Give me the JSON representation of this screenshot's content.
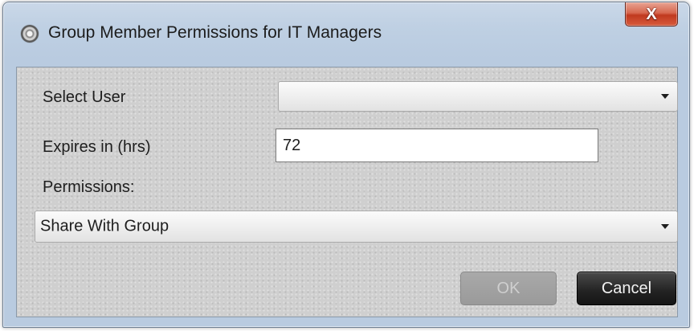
{
  "window": {
    "title": "Group Member Permissions for IT Managers",
    "close_glyph": "X"
  },
  "form": {
    "select_user_label": "Select User",
    "select_user_value": "",
    "expires_label": "Expires in (hrs)",
    "expires_value": "72",
    "permissions_label": "Permissions:",
    "permissions_value": "Share With Group"
  },
  "buttons": {
    "ok_label": "OK",
    "ok_enabled": false,
    "cancel_label": "Cancel"
  },
  "icons": {
    "app": "app-icon",
    "close": "close-icon",
    "dropdown": "chevron-down-icon"
  },
  "colors": {
    "window_frame": "#bfd0e3",
    "close_button": "#c0391f",
    "client_background": "#cfcfcf",
    "cancel_button": "#222222",
    "ok_button_disabled": "#9a9a9a"
  }
}
